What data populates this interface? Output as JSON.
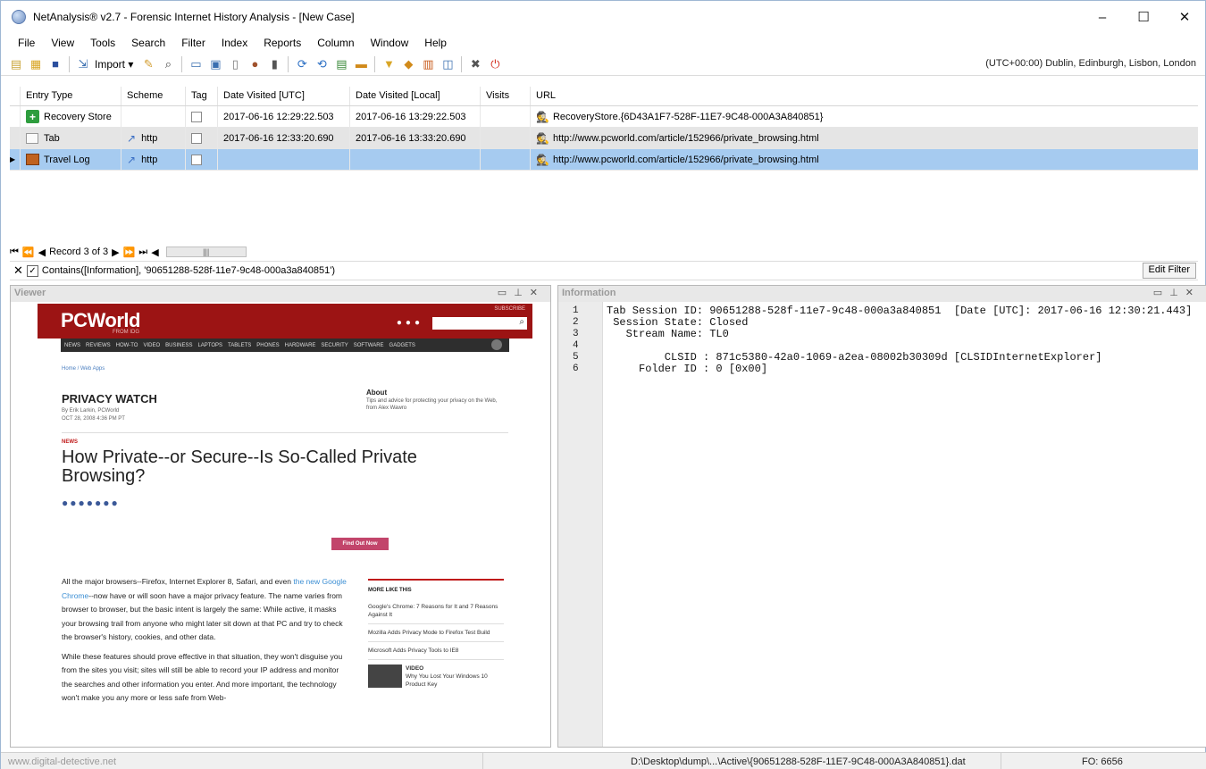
{
  "window": {
    "title": "NetAnalysis® v2.7 - Forensic Internet History Analysis - [New Case]",
    "minimize": "–",
    "maximize": "☐",
    "close": "✕"
  },
  "menu": [
    "File",
    "View",
    "Tools",
    "Search",
    "Filter",
    "Index",
    "Reports",
    "Column",
    "Window",
    "Help"
  ],
  "toolbar": {
    "import_label": "Import",
    "timezone": "(UTC+00:00) Dublin, Edinburgh, Lisbon, London"
  },
  "grid": {
    "columns": [
      "Entry Type",
      "Scheme",
      "Tag",
      "Date Visited [UTC]",
      "Date Visited [Local]",
      "Visits",
      "URL"
    ],
    "rows": [
      {
        "type": "Recovery Store",
        "scheme": "",
        "utc": "2017-06-16 12:29:22.503",
        "local": "2017-06-16 13:29:22.503",
        "visits": "",
        "url": "RecoveryStore.{6D43A1F7-528F-11E7-9C48-000A3A840851}"
      },
      {
        "type": "Tab",
        "scheme": "http",
        "utc": "2017-06-16 12:33:20.690",
        "local": "2017-06-16 13:33:20.690",
        "visits": "",
        "url": "http://www.pcworld.com/article/152966/private_browsing.html"
      },
      {
        "type": "Travel Log",
        "scheme": "http",
        "utc": "",
        "local": "",
        "visits": "",
        "url": "http://www.pcworld.com/article/152966/private_browsing.html"
      }
    ]
  },
  "record_nav": {
    "label": "Record 3 of 3"
  },
  "filter": {
    "text": "Contains([Information], '90651288-528f-11e7-9c48-000a3a840851')",
    "edit_label": "Edit Filter"
  },
  "viewer": {
    "title": "Viewer",
    "page": {
      "logo": "PCWorld",
      "logo_sub": "FROM IDG",
      "subscribe": "SUBSCRIBE",
      "nav": [
        "NEWS",
        "REVIEWS",
        "HOW-TO",
        "VIDEO",
        "BUSINESS",
        "LAPTOPS",
        "TABLETS",
        "PHONES",
        "HARDWARE",
        "SECURITY",
        "SOFTWARE",
        "GADGETS"
      ],
      "crumb": "Home / Web Apps",
      "section": "PRIVACY WATCH",
      "byline": "By Erik Larkin, PCWorld",
      "date": "OCT 28, 2008 4:36 PM PT",
      "about_title": "About",
      "about_text": "Tips and advice for protecting your privacy on the Web, from Alex Wawro",
      "tag": "NEWS",
      "headline": "How Private--or Secure--Is So-Called Private Browsing?",
      "cta": "Find Out Now",
      "para1_a": "All the major browsers--Firefox, Internet Explorer 8, Safari, and even ",
      "para1_link": "the new Google Chrome",
      "para1_b": "--now have or will soon have a major privacy feature. The name varies from browser to browser, but the basic intent is largely the same: While active, it masks your browsing trail from anyone who might later sit down at that PC and try to check the browser's history, cookies, and other data.",
      "para2": "While these features should prove effective in that situation, they won't disguise you from the sites you visit; sites will still be able to record your IP address and monitor the searches and other information you enter. And more important, the technology won't make you any more or less safe from Web-",
      "more_title": "MORE LIKE THIS",
      "more": [
        "Google's Chrome: 7 Reasons for It and 7 Reasons Against It",
        "Mozilla Adds Privacy Mode to Firefox Test Build",
        "Microsoft Adds Privacy Tools to IE8"
      ],
      "video_tag": "VIDEO",
      "video_title": "Why You Lost Your Windows 10 Product Key"
    }
  },
  "info": {
    "title": "Information",
    "lines": [
      "Tab Session ID: 90651288-528f-11e7-9c48-000a3a840851  [Date [UTC]: 2017-06-16 12:30:21.443]",
      " Session State: Closed",
      "   Stream Name: TL0",
      "",
      "         CLSID : 871c5380-42a0-1069-a2ea-08002b30309d [CLSIDInternetExplorer]",
      "     Folder ID : 0 [0x00]"
    ],
    "line_numbers": [
      "1",
      "2",
      "3",
      "4",
      "5",
      "6"
    ]
  },
  "status": {
    "site": "www.digital-detective.net",
    "path": "D:\\Desktop\\dump\\...\\Active\\{90651288-528F-11E7-9C48-000A3A840851}.dat",
    "offset": "FO: 6656"
  }
}
